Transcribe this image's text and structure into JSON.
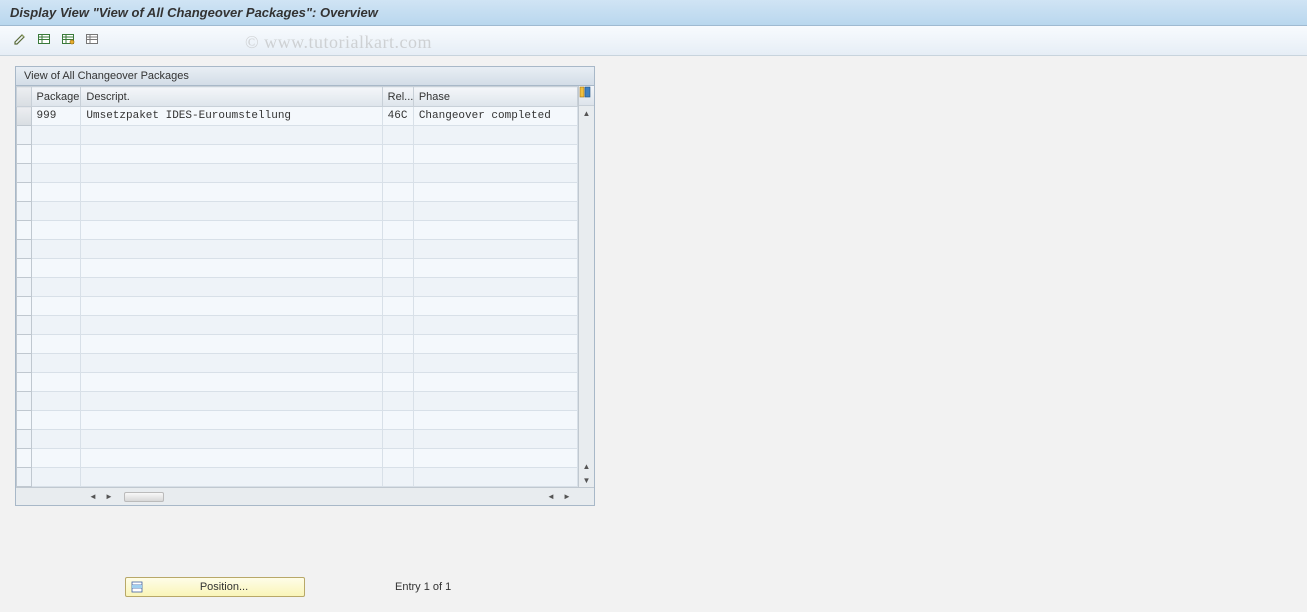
{
  "title": "Display View \"View of All Changeover Packages\": Overview",
  "watermark": "© www.tutorialkart.com",
  "table": {
    "caption": "View of All Changeover Packages",
    "columns": {
      "package": "Package",
      "descript": "Descript.",
      "rel": "Rel...",
      "phase": "Phase"
    },
    "rows": [
      {
        "package": "999",
        "descript": "Umsetzpaket IDES-Euroumstellung",
        "rel": "46C",
        "phase": "Changeover completed"
      }
    ],
    "empty_rows": 19
  },
  "footer": {
    "position_label": "Position...",
    "entry_text": "Entry 1 of 1"
  },
  "toolbar": {
    "icons": [
      "edit",
      "table-add",
      "table-copy",
      "table-plain"
    ]
  }
}
